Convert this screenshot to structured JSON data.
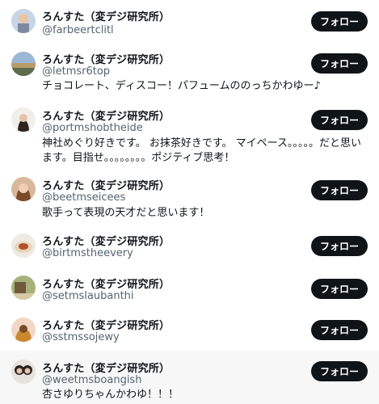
{
  "users": [
    {
      "name": "ろんすた（変デジ研究所）",
      "handle": "@farbeertclitl",
      "bio": "",
      "follow_label": "フォロー",
      "avatar_colors": [
        "#c7d6e6",
        "#7d8aa2",
        "#e9c5a3"
      ]
    },
    {
      "name": "ろんすた（変デジ研究所）",
      "handle": "@letmsr6top",
      "bio": "チョコレート、ディスコー！パフュームののっちかわゆー♪",
      "follow_label": "フォロー",
      "avatar_colors": [
        "#9db6d6",
        "#b99b6b",
        "#5d6b4f"
      ]
    },
    {
      "name": "ろんすた（変デジ研究所）",
      "handle": "@portmshobtheide",
      "bio": "神社めぐり好きです。 お抹茶好きです。 マイペース。。。。。だと思います。目指せ。。。。。。。。ポジティブ思考！",
      "follow_label": "フォロー",
      "avatar_colors": [
        "#f1efe9",
        "#2d2420",
        "#e7c1a8"
      ]
    },
    {
      "name": "ろんすた（変デジ研究所）",
      "handle": "@beetmseicees",
      "bio": "歌手って表現の天才だと思います！",
      "follow_label": "フォロー",
      "avatar_colors": [
        "#d7b89b",
        "#7a4b2a",
        "#f0cfb4"
      ]
    },
    {
      "name": "ろんすた（変デジ研究所）",
      "handle": "@birtmstheevery",
      "bio": "",
      "follow_label": "フォロー",
      "avatar_colors": [
        "#eeeae4",
        "#b5502e",
        "#e6d5b8"
      ]
    },
    {
      "name": "ろんすた（変デジ研究所）",
      "handle": "@setmslaubanthi",
      "bio": "",
      "follow_label": "フォロー",
      "avatar_colors": [
        "#a7b27a",
        "#6f5a3a",
        "#d8c9a6"
      ]
    },
    {
      "name": "ろんすた（変デジ研究所）",
      "handle": "@sstmssojewy",
      "bio": "",
      "follow_label": "フォロー",
      "avatar_colors": [
        "#f3d6c5",
        "#c9892e",
        "#7a4a2a"
      ]
    },
    {
      "name": "ろんすた（変デジ研究所）",
      "handle": "@weetmsboangish",
      "bio": "杏さゆりちゃんかわゆ！！！",
      "follow_label": "フォロー",
      "avatar_colors": [
        "#e8e2dc",
        "#2a2422",
        "#e5c2a9"
      ]
    }
  ]
}
